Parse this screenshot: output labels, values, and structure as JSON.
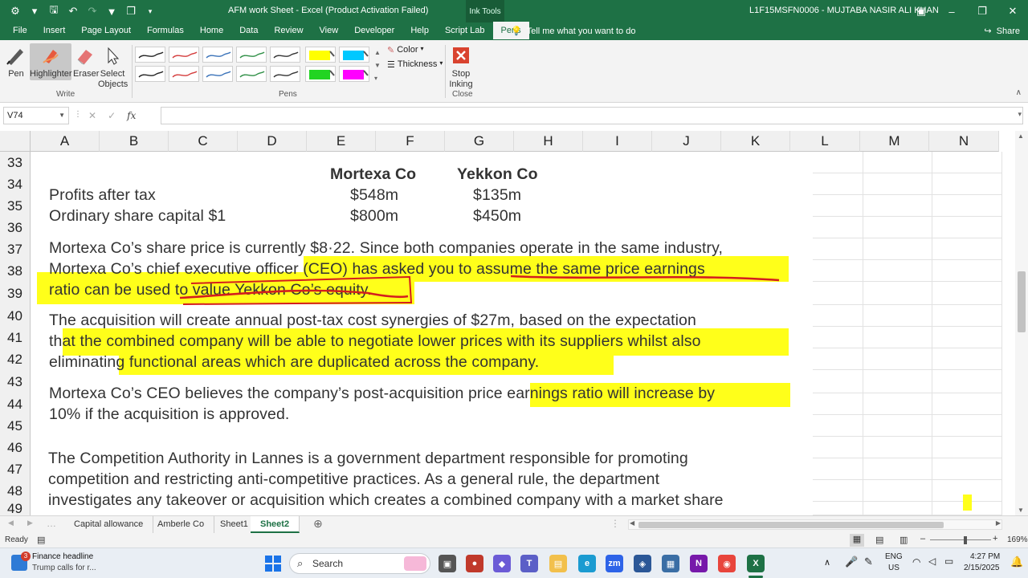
{
  "window": {
    "title": "AFM work Sheet  -  Excel (Product Activation Failed)",
    "context_tab": "Ink Tools",
    "user": "L1F15MSFN0006 - MUJTABA NASIR ALI KHAN"
  },
  "menu": {
    "tabs": [
      "File",
      "Insert",
      "Page Layout",
      "Formulas",
      "Home",
      "Data",
      "Review",
      "View",
      "Developer",
      "Help",
      "Script Lab",
      "Pens"
    ],
    "active_tab": "Pens",
    "tell_me": "Tell me what you want to do",
    "share": "Share"
  },
  "ribbon": {
    "write": {
      "pen": "Pen",
      "highlighter": "Highlighter",
      "eraser": "Eraser",
      "select_objects": "Select Objects",
      "label": "Write"
    },
    "pens": {
      "color": "Color",
      "thickness": "Thickness",
      "label": "Pens"
    },
    "close": {
      "stop_inking": "Stop Inking",
      "label": "Close"
    },
    "swatch_colors": [
      "#222222",
      "#d43c3c",
      "#3b73b9",
      "#2f8f46",
      "#333333",
      "#ffff00",
      "#00c8ff",
      "#222222",
      "#d43c3c",
      "#3b73b9",
      "#2f8f46",
      "#333333",
      "#22d422",
      "#ff00ff"
    ]
  },
  "formula_bar": {
    "name_box": "V74",
    "formula": ""
  },
  "columns": [
    "A",
    "B",
    "C",
    "D",
    "E",
    "F",
    "G",
    "H",
    "I",
    "J",
    "K",
    "L",
    "M",
    "N"
  ],
  "rows": [
    "33",
    "34",
    "35",
    "36",
    "37",
    "38",
    "39",
    "40",
    "41",
    "42",
    "43",
    "44",
    "45",
    "46",
    "47",
    "48",
    "49"
  ],
  "content": {
    "header_mortexa": "Mortexa Co",
    "header_yekkon": "Yekkon Co",
    "profits_label": "Profits after tax",
    "profits_mortexa": "$548m",
    "profits_yekkon": "$135m",
    "capital_label": "Ordinary share capital $1",
    "capital_mortexa": "$800m",
    "capital_yekkon": "$450m",
    "para1_line1": "Mortexa Co’s share price is currently $8·22. Since both companies operate in the same industry,",
    "para1_line2": "Mortexa Co’s chief executive officer (CEO) has asked you to assume the same price earnings",
    "para1_line3": "ratio can be used to value Yekkon Co’s equity.",
    "para2_line1": "The acquisition will create annual post-tax cost synergies of $27m, based on the expectation",
    "para2_line2": "that the combined company will be able to negotiate lower prices with its suppliers whilst also",
    "para2_line3": "eliminating functional areas which are duplicated across the company.",
    "para3_line1": "Mortexa Co’s CEO believes the company’s post-acquisition price earnings ratio will increase by",
    "para3_line2": "10% if the acquisition is approved.",
    "para4_line1": "The Competition Authority in Lannes is a government department responsible for promoting",
    "para4_line2": "competition and restricting anti-competitive practices. As a general rule, the department",
    "para4_line3": "investigates any takeover or acquisition which creates a combined company with a market share"
  },
  "sheets": {
    "tabs": [
      "Capital allowance",
      "Amberle Co",
      "Sheet1",
      "Sheet2"
    ],
    "active": "Sheet2"
  },
  "status": {
    "ready": "Ready",
    "zoom": "169%"
  },
  "taskbar": {
    "news_title": "Finance headline",
    "news_sub": "Trump calls for r...",
    "news_badge": "3",
    "search": "Search",
    "lang1": "ENG",
    "lang2": "US",
    "time": "4:27 PM",
    "date": "2/15/2025"
  }
}
